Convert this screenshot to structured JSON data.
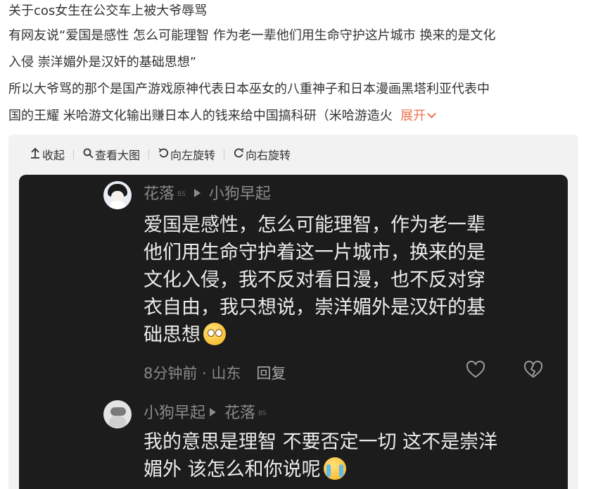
{
  "post": {
    "lines": [
      "关于cos女生在公交车上被大爷辱骂",
      "有网友说“爱国是感性 怎么可能理智 作为老一辈他们用生命守护这片城市 换来的是文化",
      "入侵 崇洋媚外是汉奸的基础思想”",
      "所以大爷骂的那个是国产游戏原神代表日本巫女的八重神子和日本漫画黑塔利亚代表中",
      "国的王耀 米哈游文化输出赚日本人的钱来给中国搞科研（米哈游造火"
    ],
    "expand_label": "展开"
  },
  "toolbar": {
    "collapse": "收起",
    "view_large": "查看大图",
    "rotate_left": "向左旋转",
    "rotate_right": "向右旋转"
  },
  "screenshot": {
    "comment1": {
      "user": "花落",
      "badge": "BS",
      "reply_to": "小狗早起",
      "lines": [
        "爱国是感性，怎么可能理智，作为老一辈",
        "他们用生命守护着这一片城市，换来的是",
        "文化入侵，我不反对看日漫，也不反对穿",
        "衣自由，我只想说，崇洋媚外是汉奸的基",
        "础思想"
      ],
      "emoji": "eye-roll-emoji",
      "time": "8分钟前 · 山东",
      "reply_label": "回复"
    },
    "comment2": {
      "user": "小狗早起",
      "reply_to": "花落",
      "badge": "BS",
      "lines": [
        "我的意思是理智 不要否定一切 这不是崇洋",
        "媚外 该怎么和你说呢"
      ],
      "emoji": "crying-emoji"
    }
  },
  "icons": {
    "collapse": "arrow-up-icon",
    "view_large": "magnifier-icon",
    "rotate_left": "rotate-left-icon",
    "rotate_right": "rotate-right-icon",
    "like": "heart-outline-icon",
    "dislike": "broken-heart-icon"
  },
  "colors": {
    "accent": "#eb7350",
    "viewer_bg": "#f2f2f2",
    "screenshot_bg": "#1c1c1c"
  }
}
